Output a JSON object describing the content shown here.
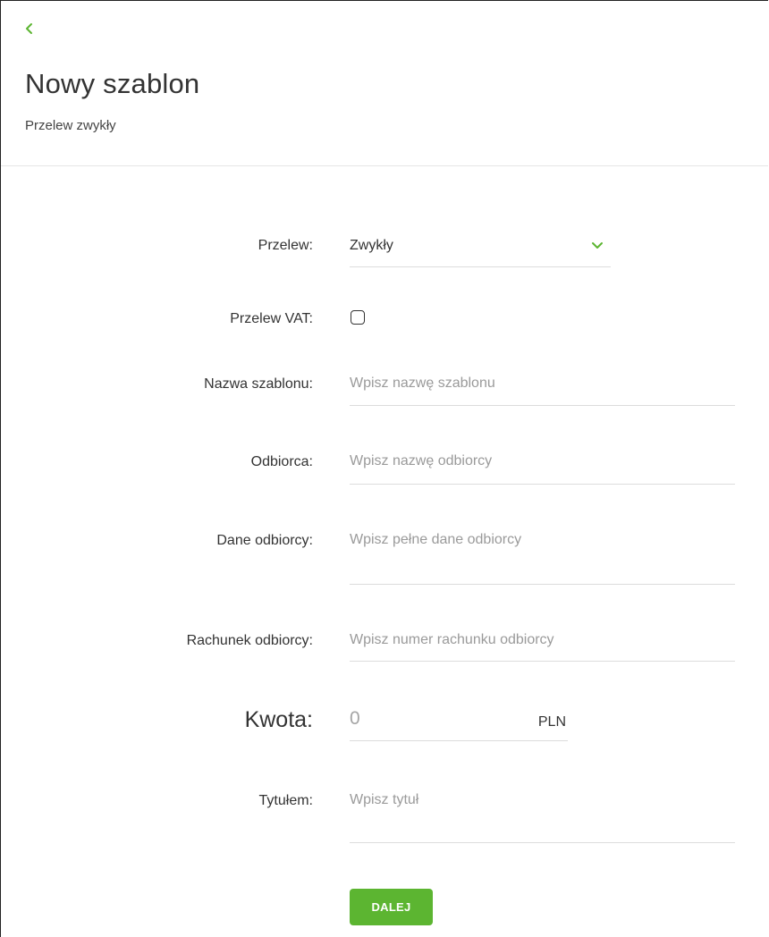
{
  "colors": {
    "accent": "#5cb531",
    "text": "#333333",
    "placeholder": "#9a9a9a",
    "underline": "#dcdcdc"
  },
  "header": {
    "back_icon": "chevron-left-icon",
    "title": "Nowy szablon",
    "subtitle": "Przelew zwykły"
  },
  "form": {
    "transfer_type": {
      "label": "Przelew:",
      "value": "Zwykły",
      "icon": "chevron-down-icon"
    },
    "vat": {
      "label": "Przelew VAT:",
      "checked": false
    },
    "template_name": {
      "label": "Nazwa szablonu:",
      "placeholder": "Wpisz nazwę szablonu"
    },
    "recipient": {
      "label": "Odbiorca:",
      "placeholder": "Wpisz nazwę odbiorcy"
    },
    "recipient_details": {
      "label": "Dane odbiorcy:",
      "placeholder": "Wpisz pełne dane odbiorcy"
    },
    "recipient_account": {
      "label": "Rachunek odbiorcy:",
      "placeholder": "Wpisz numer rachunku odbiorcy"
    },
    "amount": {
      "label": "Kwota:",
      "value": "0",
      "currency": "PLN"
    },
    "title": {
      "label": "Tytułem:",
      "placeholder": "Wpisz tytuł"
    }
  },
  "actions": {
    "next_label": "DALEJ"
  }
}
